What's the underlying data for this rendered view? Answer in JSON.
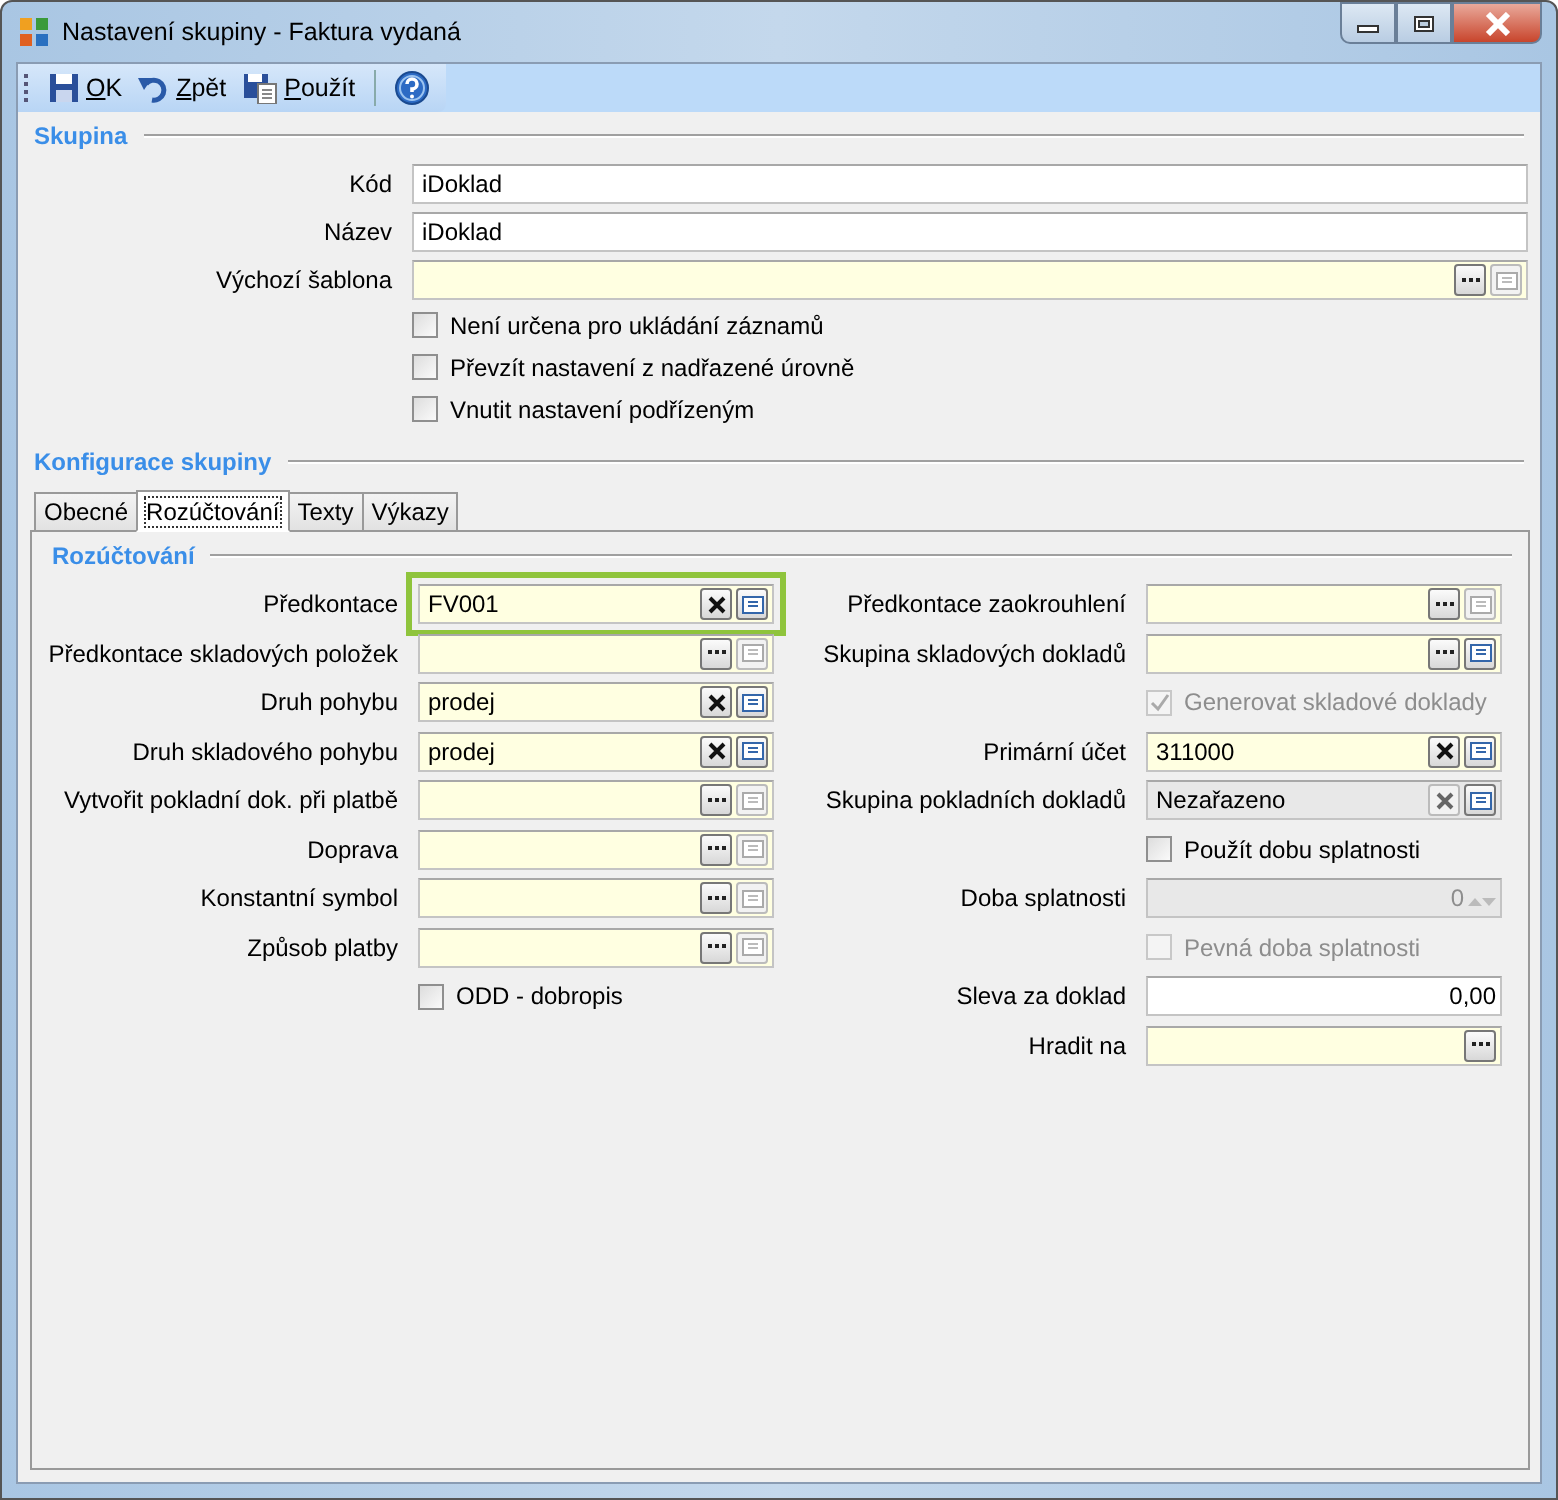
{
  "window": {
    "title": "Nastavení skupiny - Faktura vydaná"
  },
  "toolbar": [
    {
      "kind": "save",
      "label": "OK"
    },
    {
      "kind": "undo",
      "label": "Zpět"
    },
    {
      "kind": "apply",
      "label": "Použít"
    },
    {
      "kind": "help"
    }
  ],
  "skupina": {
    "title": "Skupina",
    "fields": [
      {
        "kind": "text",
        "label": "Kód",
        "value": "iDoklad"
      },
      {
        "kind": "text",
        "label": "Název",
        "value": "iDoklad"
      },
      {
        "kind": "lookup",
        "label": "Výchozí šablona",
        "buttons": [
          {
            "kind": "browse",
            "disabled": false
          },
          {
            "kind": "detail",
            "disabled": true
          }
        ]
      },
      {
        "kind": "checkbox",
        "label": "Není určena pro ukládání záznamů",
        "checked": false,
        "disabled": false
      },
      {
        "kind": "checkbox",
        "label": "Převzít nastavení z nadřazené úrovně",
        "checked": false,
        "disabled": false
      },
      {
        "kind": "checkbox",
        "label": "Vnutit nastavení podřízeným",
        "checked": false,
        "disabled": false
      }
    ]
  },
  "konfigurace": {
    "title": "Konfigurace skupiny",
    "tabs": [
      {
        "label": "Obecné",
        "selected": false
      },
      {
        "label": "Rozúčtování",
        "selected": true
      },
      {
        "label": "Texty",
        "selected": false
      },
      {
        "label": "Výkazy",
        "selected": false
      }
    ],
    "section": {
      "title": "Rozúčtování",
      "left": [
        {
          "kind": "lookup",
          "label": "Předkontace",
          "value": "FV001",
          "highlighted": true,
          "buttons": [
            {
              "kind": "clear",
              "disabled": false
            },
            {
              "kind": "detail",
              "disabled": false
            }
          ]
        },
        {
          "kind": "lookup",
          "label": "Předkontace skladových položek",
          "buttons": [
            {
              "kind": "browse",
              "disabled": false
            },
            {
              "kind": "detail",
              "disabled": true
            }
          ]
        },
        {
          "kind": "lookup",
          "label": "Druh pohybu",
          "value": "prodej",
          "buttons": [
            {
              "kind": "clear",
              "disabled": false
            },
            {
              "kind": "detail",
              "disabled": false
            }
          ]
        },
        {
          "kind": "lookup",
          "label": "Druh skladového pohybu",
          "value": "prodej",
          "buttons": [
            {
              "kind": "clear",
              "disabled": false
            },
            {
              "kind": "detail",
              "disabled": false
            }
          ]
        },
        {
          "kind": "lookup",
          "label": "Vytvořit pokladní dok. při platbě",
          "buttons": [
            {
              "kind": "browse",
              "disabled": false
            },
            {
              "kind": "detail",
              "disabled": true
            }
          ]
        },
        {
          "kind": "lookup",
          "label": "Doprava",
          "buttons": [
            {
              "kind": "browse",
              "disabled": false
            },
            {
              "kind": "detail",
              "disabled": true
            }
          ]
        },
        {
          "kind": "lookup",
          "label": "Konstantní symbol",
          "buttons": [
            {
              "kind": "browse",
              "disabled": false
            },
            {
              "kind": "detail",
              "disabled": true
            }
          ]
        },
        {
          "kind": "lookup",
          "label": "Způsob platby",
          "buttons": [
            {
              "kind": "browse",
              "disabled": false
            },
            {
              "kind": "detail",
              "disabled": true
            }
          ]
        },
        {
          "kind": "checkbox",
          "label": "ODD - dobropis",
          "checked": false,
          "disabled": false
        }
      ],
      "right": [
        {
          "kind": "lookup",
          "label": "Předkontace zaokrouhlení",
          "buttons": [
            {
              "kind": "browse",
              "disabled": false
            },
            {
              "kind": "detail",
              "disabled": true
            }
          ]
        },
        {
          "kind": "lookup",
          "label": "Skupina skladových dokladů",
          "buttons": [
            {
              "kind": "browse",
              "disabled": false
            },
            {
              "kind": "detail",
              "disabled": false
            }
          ]
        },
        {
          "kind": "checkbox",
          "label": "Generovat skladové doklady",
          "checked": true,
          "disabled": true
        },
        {
          "kind": "lookup",
          "label": "Primární účet",
          "value": "311000",
          "buttons": [
            {
              "kind": "clear",
              "disabled": false
            },
            {
              "kind": "detail",
              "disabled": false
            }
          ]
        },
        {
          "kind": "lookup",
          "label": "Skupina pokladních dokladů",
          "value": "Nezařazeno",
          "disabled": true,
          "buttons": [
            {
              "kind": "clear",
              "disabled": true
            },
            {
              "kind": "detail",
              "disabled": false
            }
          ]
        },
        {
          "kind": "checkbox",
          "label": "Použít dobu splatnosti",
          "checked": false,
          "disabled": false
        },
        {
          "kind": "spin",
          "label": "Doba splatnosti",
          "value": "0",
          "disabled": true
        },
        {
          "kind": "checkbox",
          "label": "Pevná doba splatnosti",
          "checked": false,
          "disabled": true
        },
        {
          "kind": "number",
          "label": "Sleva za doklad",
          "value": "0,00"
        },
        {
          "kind": "lookup",
          "label": "Hradit na",
          "buttons": [
            {
              "kind": "browse",
              "disabled": false
            }
          ]
        }
      ]
    }
  }
}
